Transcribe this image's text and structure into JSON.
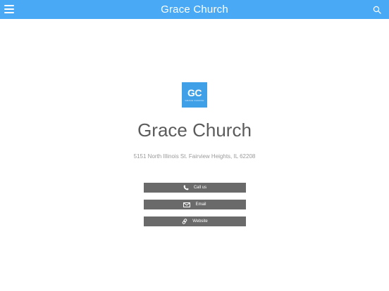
{
  "header": {
    "title": "Grace Church",
    "menu_icon": "hamburger-menu-icon",
    "search_icon": "search-icon",
    "background": "#4aa9f4"
  },
  "logo": {
    "mark": "GC",
    "subtitle": "GRACE CHURCH",
    "background": "#3fa0e8"
  },
  "church": {
    "name": "Grace Church",
    "address": "5151 North Illinois St. Fairview Heights, IL 62208"
  },
  "actions": {
    "call_label": "Call us",
    "email_label": "Email",
    "website_label": "Website",
    "button_color": "#6a6a6a"
  }
}
